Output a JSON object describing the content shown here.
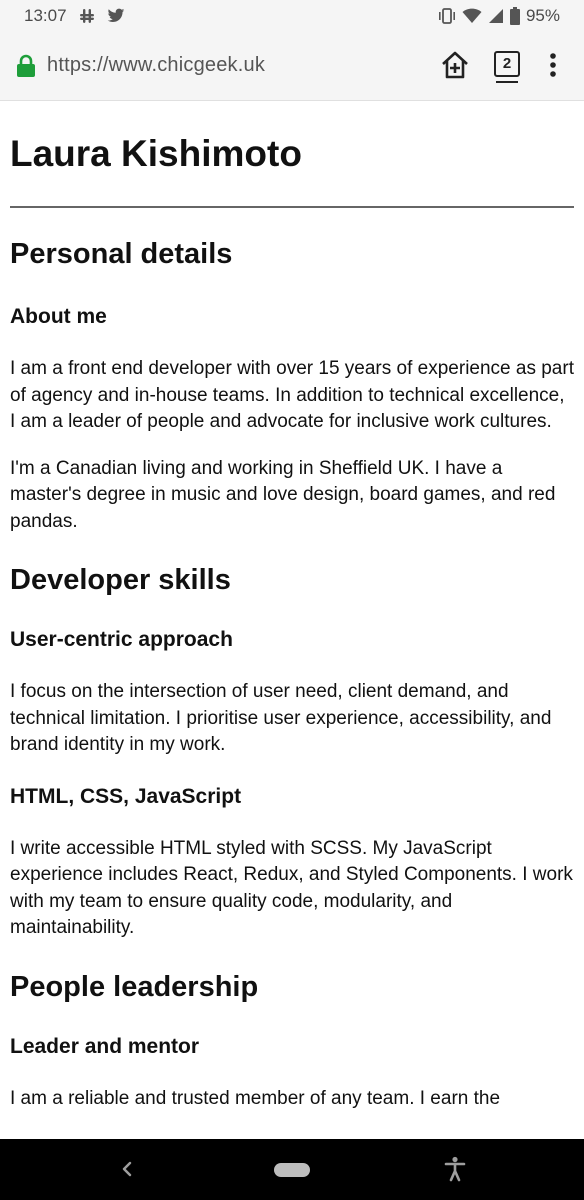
{
  "status_bar": {
    "time": "13:07",
    "battery": "95%"
  },
  "browser": {
    "url": "https://www.chicgeek.uk",
    "tab_count": "2"
  },
  "page": {
    "title": "Laura Kishimoto",
    "sections": [
      {
        "heading": "Personal details",
        "subsections": [
          {
            "heading": "About me",
            "paragraphs": [
              "I am a front end developer with over 15 years of experience as part of agency and in-house teams. In addition to technical excellence, I am a leader of people and advocate for inclusive work cultures.",
              "I'm a Canadian living and working in Sheffield UK. I have a master's degree in music and love design, board games, and red pandas."
            ]
          }
        ]
      },
      {
        "heading": "Developer skills",
        "subsections": [
          {
            "heading": "User-centric approach",
            "paragraphs": [
              "I focus on the intersection of user need, client demand, and technical limitation. I prioritise user experience, accessibility, and brand identity in my work."
            ]
          },
          {
            "heading": "HTML, CSS, JavaScript",
            "paragraphs": [
              "I write accessible HTML styled with SCSS. My JavaScript experience includes React, Redux, and Styled Components. I work with my team to ensure quality code, modularity, and maintainability."
            ]
          }
        ]
      },
      {
        "heading": "People leadership",
        "subsections": [
          {
            "heading": "Leader and mentor",
            "paragraphs": [
              "I am a reliable and trusted member of any team. I earn the"
            ]
          }
        ]
      }
    ]
  },
  "colors": {
    "lock_green": "#1e9e3a",
    "chrome_bg": "#f5f5f5",
    "nav_bg": "#000000"
  },
  "icons": [
    "slack-icon",
    "twitter-icon",
    "vibrate-icon",
    "wifi-icon",
    "signal-icon",
    "battery-icon",
    "lock-icon",
    "add-to-home-icon",
    "tab-switcher-icon",
    "more-vert-icon",
    "back-icon",
    "home-pill-icon",
    "accessibility-icon"
  ]
}
